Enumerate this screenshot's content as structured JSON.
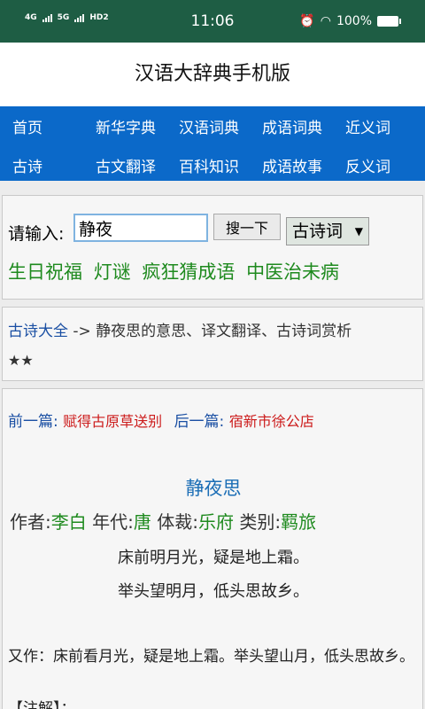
{
  "status_bar": {
    "left": [
      "4G",
      "5G",
      "HD2"
    ],
    "time": "11:06",
    "battery": "100%"
  },
  "app": {
    "title": "汉语大辞典手机版"
  },
  "nav": {
    "row1": [
      "首页",
      "新华字典",
      "汉语词典",
      "成语词典",
      "近义词"
    ],
    "row2": [
      "古诗",
      "古文翻译",
      "百科知识",
      "成语故事",
      "反义词"
    ]
  },
  "search": {
    "label": "请输入:",
    "value": "静夜",
    "button": "搜一下",
    "select": "古诗词",
    "links": [
      "生日祝福",
      "灯谜",
      "疯狂猜成语",
      "中医治未病"
    ]
  },
  "breadcrumb": {
    "link": "古诗大全",
    "text": " -> 静夜思的意思、译文翻译、古诗词赏析",
    "stars": "★★"
  },
  "poem": {
    "prev_label": "前一篇:",
    "prev": "赋得古原草送别",
    "next_label": "后一篇:",
    "next": "宿新市徐公店",
    "title": "静夜思",
    "author_label": "作者:",
    "author": "李白",
    "era_label": "年代:",
    "era": "唐",
    "form_label": "体裁:",
    "form": "乐府",
    "category_label": "类别:",
    "category": "羁旅",
    "lines": [
      "床前明月光，疑是地上霜。",
      "举头望明月，低头思故乡。"
    ],
    "alt_text": "又作：床前看月光，疑是地上霜。举头望山月，低头思故乡。",
    "note": "【注解】："
  },
  "colors": {
    "status": "#1e5d44",
    "nav": "#0b69c9",
    "green": "#1e8a1e",
    "red": "#cc1b1b",
    "blue": "#1a6db5"
  }
}
